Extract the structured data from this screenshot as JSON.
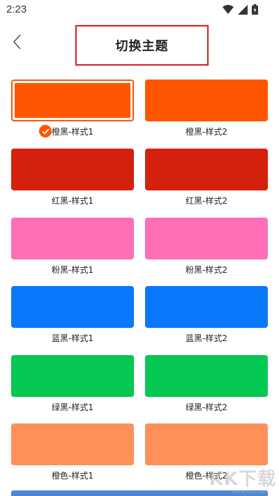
{
  "status_bar": {
    "time": "2:23"
  },
  "header": {
    "title": "切换主题"
  },
  "themes": [
    {
      "label": "橙黑-样式1",
      "color": "#ff5500",
      "selected": true
    },
    {
      "label": "橙黑-样式2",
      "color": "#ff5500",
      "selected": false
    },
    {
      "label": "红黑-样式1",
      "color": "#d6200e",
      "selected": false
    },
    {
      "label": "红黑-样式2",
      "color": "#d6200e",
      "selected": false
    },
    {
      "label": "粉黑-样式1",
      "color": "#ff6fb6",
      "selected": false
    },
    {
      "label": "粉黑-样式2",
      "color": "#ff6fb6",
      "selected": false
    },
    {
      "label": "蓝黑-样式1",
      "color": "#0a78fa",
      "selected": false
    },
    {
      "label": "蓝黑-样式2",
      "color": "#0a78fa",
      "selected": false
    },
    {
      "label": "绿黑-样式1",
      "color": "#05c853",
      "selected": false
    },
    {
      "label": "绿黑-样式2",
      "color": "#05c853",
      "selected": false
    },
    {
      "label": "橙色-样式1",
      "color": "#ff9059",
      "selected": false
    },
    {
      "label": "橙色-样式2",
      "color": "#ff9059",
      "selected": false
    }
  ],
  "watermark": {
    "text": "KK下载",
    "sub": "www.kkx.net"
  }
}
